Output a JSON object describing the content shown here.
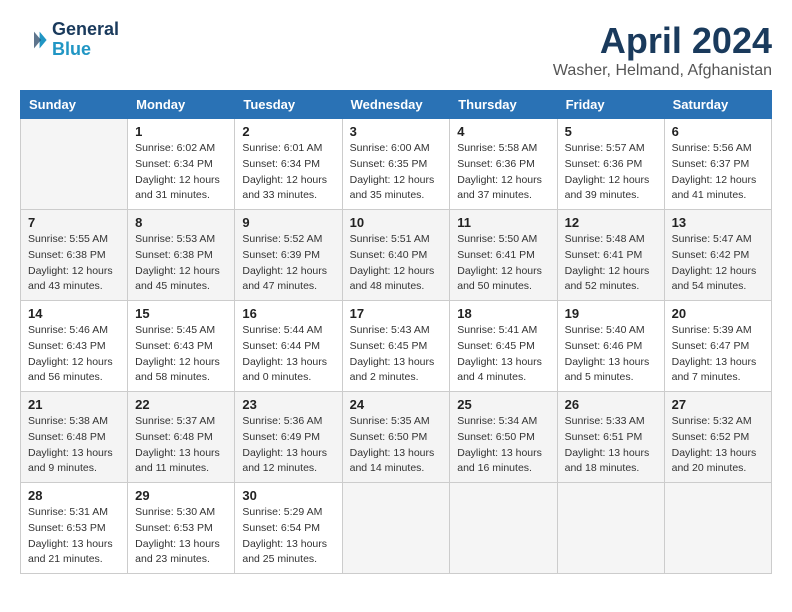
{
  "header": {
    "logo_line1": "General",
    "logo_line2": "Blue",
    "title": "April 2024",
    "subtitle": "Washer, Helmand, Afghanistan"
  },
  "columns": [
    "Sunday",
    "Monday",
    "Tuesday",
    "Wednesday",
    "Thursday",
    "Friday",
    "Saturday"
  ],
  "weeks": [
    [
      {
        "day": "",
        "info": ""
      },
      {
        "day": "1",
        "info": "Sunrise: 6:02 AM\nSunset: 6:34 PM\nDaylight: 12 hours\nand 31 minutes."
      },
      {
        "day": "2",
        "info": "Sunrise: 6:01 AM\nSunset: 6:34 PM\nDaylight: 12 hours\nand 33 minutes."
      },
      {
        "day": "3",
        "info": "Sunrise: 6:00 AM\nSunset: 6:35 PM\nDaylight: 12 hours\nand 35 minutes."
      },
      {
        "day": "4",
        "info": "Sunrise: 5:58 AM\nSunset: 6:36 PM\nDaylight: 12 hours\nand 37 minutes."
      },
      {
        "day": "5",
        "info": "Sunrise: 5:57 AM\nSunset: 6:36 PM\nDaylight: 12 hours\nand 39 minutes."
      },
      {
        "day": "6",
        "info": "Sunrise: 5:56 AM\nSunset: 6:37 PM\nDaylight: 12 hours\nand 41 minutes."
      }
    ],
    [
      {
        "day": "7",
        "info": "Sunrise: 5:55 AM\nSunset: 6:38 PM\nDaylight: 12 hours\nand 43 minutes."
      },
      {
        "day": "8",
        "info": "Sunrise: 5:53 AM\nSunset: 6:38 PM\nDaylight: 12 hours\nand 45 minutes."
      },
      {
        "day": "9",
        "info": "Sunrise: 5:52 AM\nSunset: 6:39 PM\nDaylight: 12 hours\nand 47 minutes."
      },
      {
        "day": "10",
        "info": "Sunrise: 5:51 AM\nSunset: 6:40 PM\nDaylight: 12 hours\nand 48 minutes."
      },
      {
        "day": "11",
        "info": "Sunrise: 5:50 AM\nSunset: 6:41 PM\nDaylight: 12 hours\nand 50 minutes."
      },
      {
        "day": "12",
        "info": "Sunrise: 5:48 AM\nSunset: 6:41 PM\nDaylight: 12 hours\nand 52 minutes."
      },
      {
        "day": "13",
        "info": "Sunrise: 5:47 AM\nSunset: 6:42 PM\nDaylight: 12 hours\nand 54 minutes."
      }
    ],
    [
      {
        "day": "14",
        "info": "Sunrise: 5:46 AM\nSunset: 6:43 PM\nDaylight: 12 hours\nand 56 minutes."
      },
      {
        "day": "15",
        "info": "Sunrise: 5:45 AM\nSunset: 6:43 PM\nDaylight: 12 hours\nand 58 minutes."
      },
      {
        "day": "16",
        "info": "Sunrise: 5:44 AM\nSunset: 6:44 PM\nDaylight: 13 hours\nand 0 minutes."
      },
      {
        "day": "17",
        "info": "Sunrise: 5:43 AM\nSunset: 6:45 PM\nDaylight: 13 hours\nand 2 minutes."
      },
      {
        "day": "18",
        "info": "Sunrise: 5:41 AM\nSunset: 6:45 PM\nDaylight: 13 hours\nand 4 minutes."
      },
      {
        "day": "19",
        "info": "Sunrise: 5:40 AM\nSunset: 6:46 PM\nDaylight: 13 hours\nand 5 minutes."
      },
      {
        "day": "20",
        "info": "Sunrise: 5:39 AM\nSunset: 6:47 PM\nDaylight: 13 hours\nand 7 minutes."
      }
    ],
    [
      {
        "day": "21",
        "info": "Sunrise: 5:38 AM\nSunset: 6:48 PM\nDaylight: 13 hours\nand 9 minutes."
      },
      {
        "day": "22",
        "info": "Sunrise: 5:37 AM\nSunset: 6:48 PM\nDaylight: 13 hours\nand 11 minutes."
      },
      {
        "day": "23",
        "info": "Sunrise: 5:36 AM\nSunset: 6:49 PM\nDaylight: 13 hours\nand 12 minutes."
      },
      {
        "day": "24",
        "info": "Sunrise: 5:35 AM\nSunset: 6:50 PM\nDaylight: 13 hours\nand 14 minutes."
      },
      {
        "day": "25",
        "info": "Sunrise: 5:34 AM\nSunset: 6:50 PM\nDaylight: 13 hours\nand 16 minutes."
      },
      {
        "day": "26",
        "info": "Sunrise: 5:33 AM\nSunset: 6:51 PM\nDaylight: 13 hours\nand 18 minutes."
      },
      {
        "day": "27",
        "info": "Sunrise: 5:32 AM\nSunset: 6:52 PM\nDaylight: 13 hours\nand 20 minutes."
      }
    ],
    [
      {
        "day": "28",
        "info": "Sunrise: 5:31 AM\nSunset: 6:53 PM\nDaylight: 13 hours\nand 21 minutes."
      },
      {
        "day": "29",
        "info": "Sunrise: 5:30 AM\nSunset: 6:53 PM\nDaylight: 13 hours\nand 23 minutes."
      },
      {
        "day": "30",
        "info": "Sunrise: 5:29 AM\nSunset: 6:54 PM\nDaylight: 13 hours\nand 25 minutes."
      },
      {
        "day": "",
        "info": ""
      },
      {
        "day": "",
        "info": ""
      },
      {
        "day": "",
        "info": ""
      },
      {
        "day": "",
        "info": ""
      }
    ]
  ]
}
